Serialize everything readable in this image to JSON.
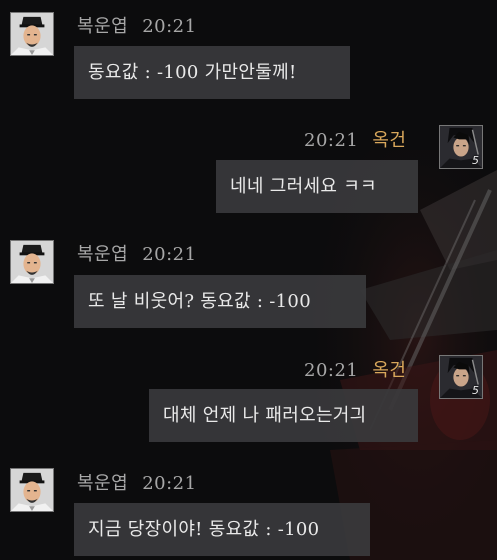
{
  "chat": {
    "messages": [
      {
        "sender": "복운엽",
        "time": "20:21",
        "text": "동요값 : -100  가만안둘께!",
        "outgoing": false,
        "avatar": "scholar-avatar-icon"
      },
      {
        "sender": "옥건",
        "time": "20:21",
        "text": "네네 그러세요 ㅋㅋ",
        "outgoing": true,
        "avatar": "swordsman-avatar-icon",
        "level": "5"
      },
      {
        "sender": "복운엽",
        "time": "20:21",
        "text": "또 날 비웃어? 동요값 : -100",
        "outgoing": false,
        "avatar": "scholar-avatar-icon"
      },
      {
        "sender": "옥건",
        "time": "20:21",
        "text": "대체 언제 나 패러오는거긔",
        "outgoing": true,
        "avatar": "swordsman-avatar-icon",
        "level": "5"
      },
      {
        "sender": "복운엽",
        "time": "20:21",
        "text": "지금 당장이야! 동요값 : -100",
        "outgoing": false,
        "avatar": "scholar-avatar-icon"
      }
    ]
  },
  "colors": {
    "background": "#0c0c0d",
    "bubble": "#3a3a3c",
    "message_text": "#e9e9e9",
    "meta_text": "#a7a7a7",
    "outgoing_sender": "#d9a85c"
  }
}
